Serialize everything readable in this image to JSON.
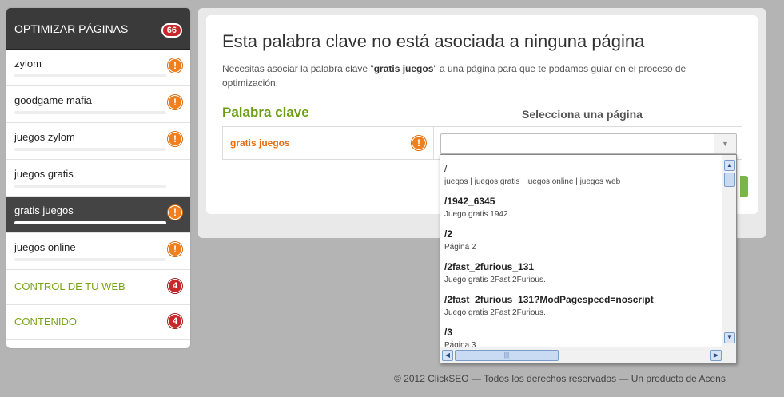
{
  "sidebar": {
    "header": {
      "label": "OPTIMIZAR PÁGINAS",
      "count": "66"
    },
    "keywords": [
      {
        "label": "zylom",
        "badge": "!",
        "active": false
      },
      {
        "label": "goodgame mafia",
        "badge": "!",
        "active": false
      },
      {
        "label": "juegos zylom",
        "badge": "!",
        "active": false
      },
      {
        "label": "juegos gratis",
        "badge": "",
        "active": false
      },
      {
        "label": "gratis juegos",
        "badge": "!",
        "active": true
      },
      {
        "label": "juegos online",
        "badge": "!",
        "active": false
      }
    ],
    "links": [
      {
        "label": "CONTROL DE TU WEB",
        "count": "4"
      },
      {
        "label": "CONTENIDO",
        "count": "4"
      }
    ]
  },
  "main": {
    "title": "Esta palabra clave no está asociada a ninguna página",
    "desc_before": "Necesitas asociar la palabra clave \"",
    "desc_keyword": "gratis juegos",
    "desc_after": "\" a una página para que te podamos guiar en el proceso de optimización.",
    "col_keyword": "Palabra clave",
    "col_page": "Selecciona una página",
    "keyword": "gratis juegos",
    "select_value": ""
  },
  "dropdown": {
    "items": [
      {
        "path": "/",
        "desc": "juegos | juegos gratis | juegos online | juegos web"
      },
      {
        "path": "/1942_6345",
        "desc": "Juego gratis 1942."
      },
      {
        "path": "/2",
        "desc": "Página 2"
      },
      {
        "path": "/2fast_2furious_131",
        "desc": "Juego gratis 2Fast 2Furious."
      },
      {
        "path": "/2fast_2furious_131?ModPagespeed=noscript",
        "desc": "Juego gratis 2Fast 2Furious."
      },
      {
        "path": "/3",
        "desc": "Página 3"
      }
    ]
  },
  "footer": {
    "text": "© 2012 ClickSEO — Todos los derechos reservados — Un producto de Acens"
  },
  "colors": {
    "accent_green": "#6a9e12",
    "warning_orange": "#f07f1e",
    "badge_red": "#c8282a"
  }
}
